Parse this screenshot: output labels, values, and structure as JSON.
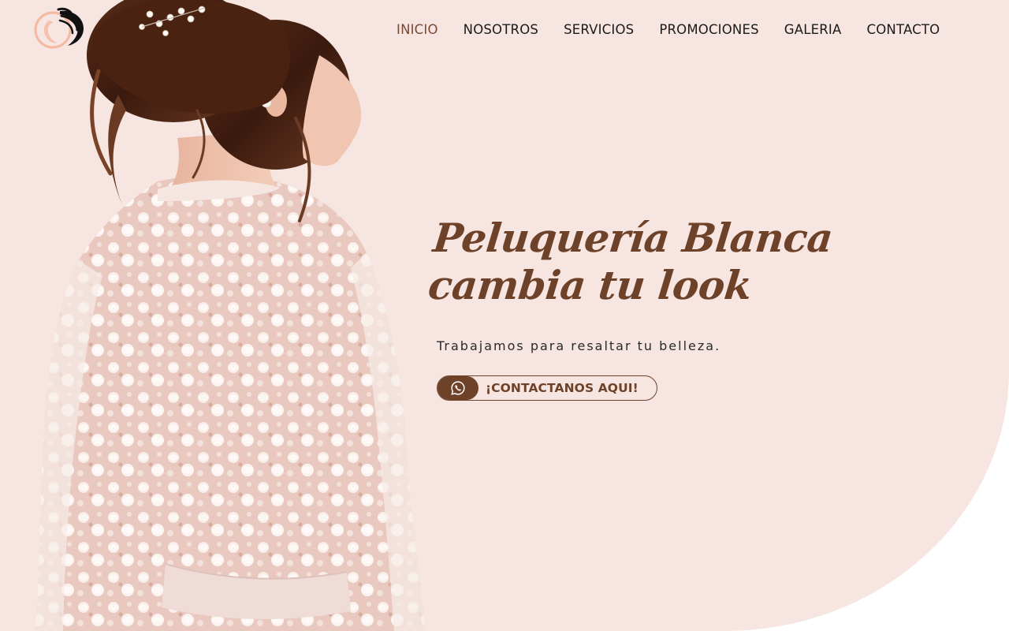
{
  "brand": {
    "logo_icon": "woman-silhouette-hair-logo"
  },
  "nav": {
    "items": [
      {
        "label": "INICIO",
        "active": true
      },
      {
        "label": "NOSOTROS",
        "active": false
      },
      {
        "label": "SERVICIOS",
        "active": false
      },
      {
        "label": "PROMOCIONES",
        "active": false
      },
      {
        "label": "GALERIA",
        "active": false
      },
      {
        "label": "CONTACTO",
        "active": false
      }
    ]
  },
  "hero": {
    "title_line1": "Peluquería Blanca",
    "title_line2": "cambia tu look",
    "subtitle": "Trabajamos para resaltar tu belleza.",
    "cta_label": "¡CONTACTANOS AQUI!",
    "cta_icon": "whatsapp-icon",
    "image": "woman-lace-robe-updo-photo"
  },
  "colors": {
    "background": "#f6e5e0",
    "accent_brown": "#6e4129",
    "nav_active": "#7b4a35",
    "nav_text": "#1b1b1b",
    "logo_peach": "#f5b8a0"
  }
}
